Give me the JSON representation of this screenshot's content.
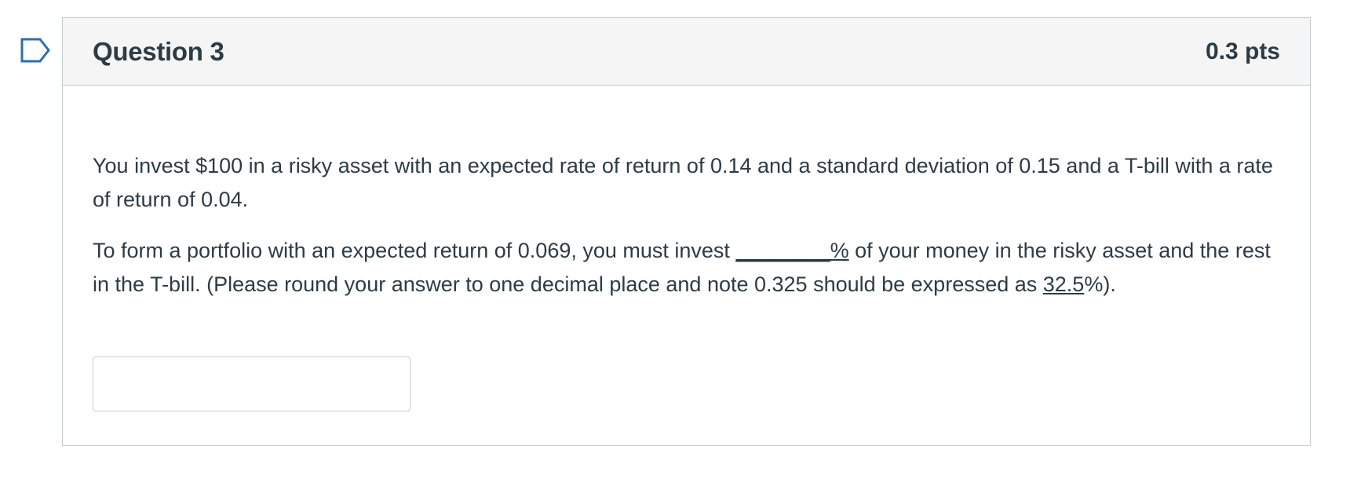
{
  "question": {
    "title": "Question 3",
    "points": "0.3 pts",
    "paragraph1": "You invest $100 in a risky asset with an expected rate of return of 0.14 and a standard deviation of 0.15 and a T-bill with a rate of return of 0.04.",
    "paragraph2": {
      "part1": "To form a portfolio with an expected return of 0.069, you must invest ",
      "blank": "________%",
      "part2": " of your money in the risky asset and the rest in the T-bill. (Please round your answer to one decimal place and note 0.325 should be expressed as ",
      "example": "32.5",
      "part3": "%)."
    },
    "answer": {
      "value": "",
      "placeholder": ""
    }
  },
  "colors": {
    "text": "#2d3b45",
    "header_bg": "#f5f5f5",
    "border": "#c7cdd1",
    "flag": "#2d6fae"
  },
  "icons": {
    "flag": "flag-question-icon"
  }
}
